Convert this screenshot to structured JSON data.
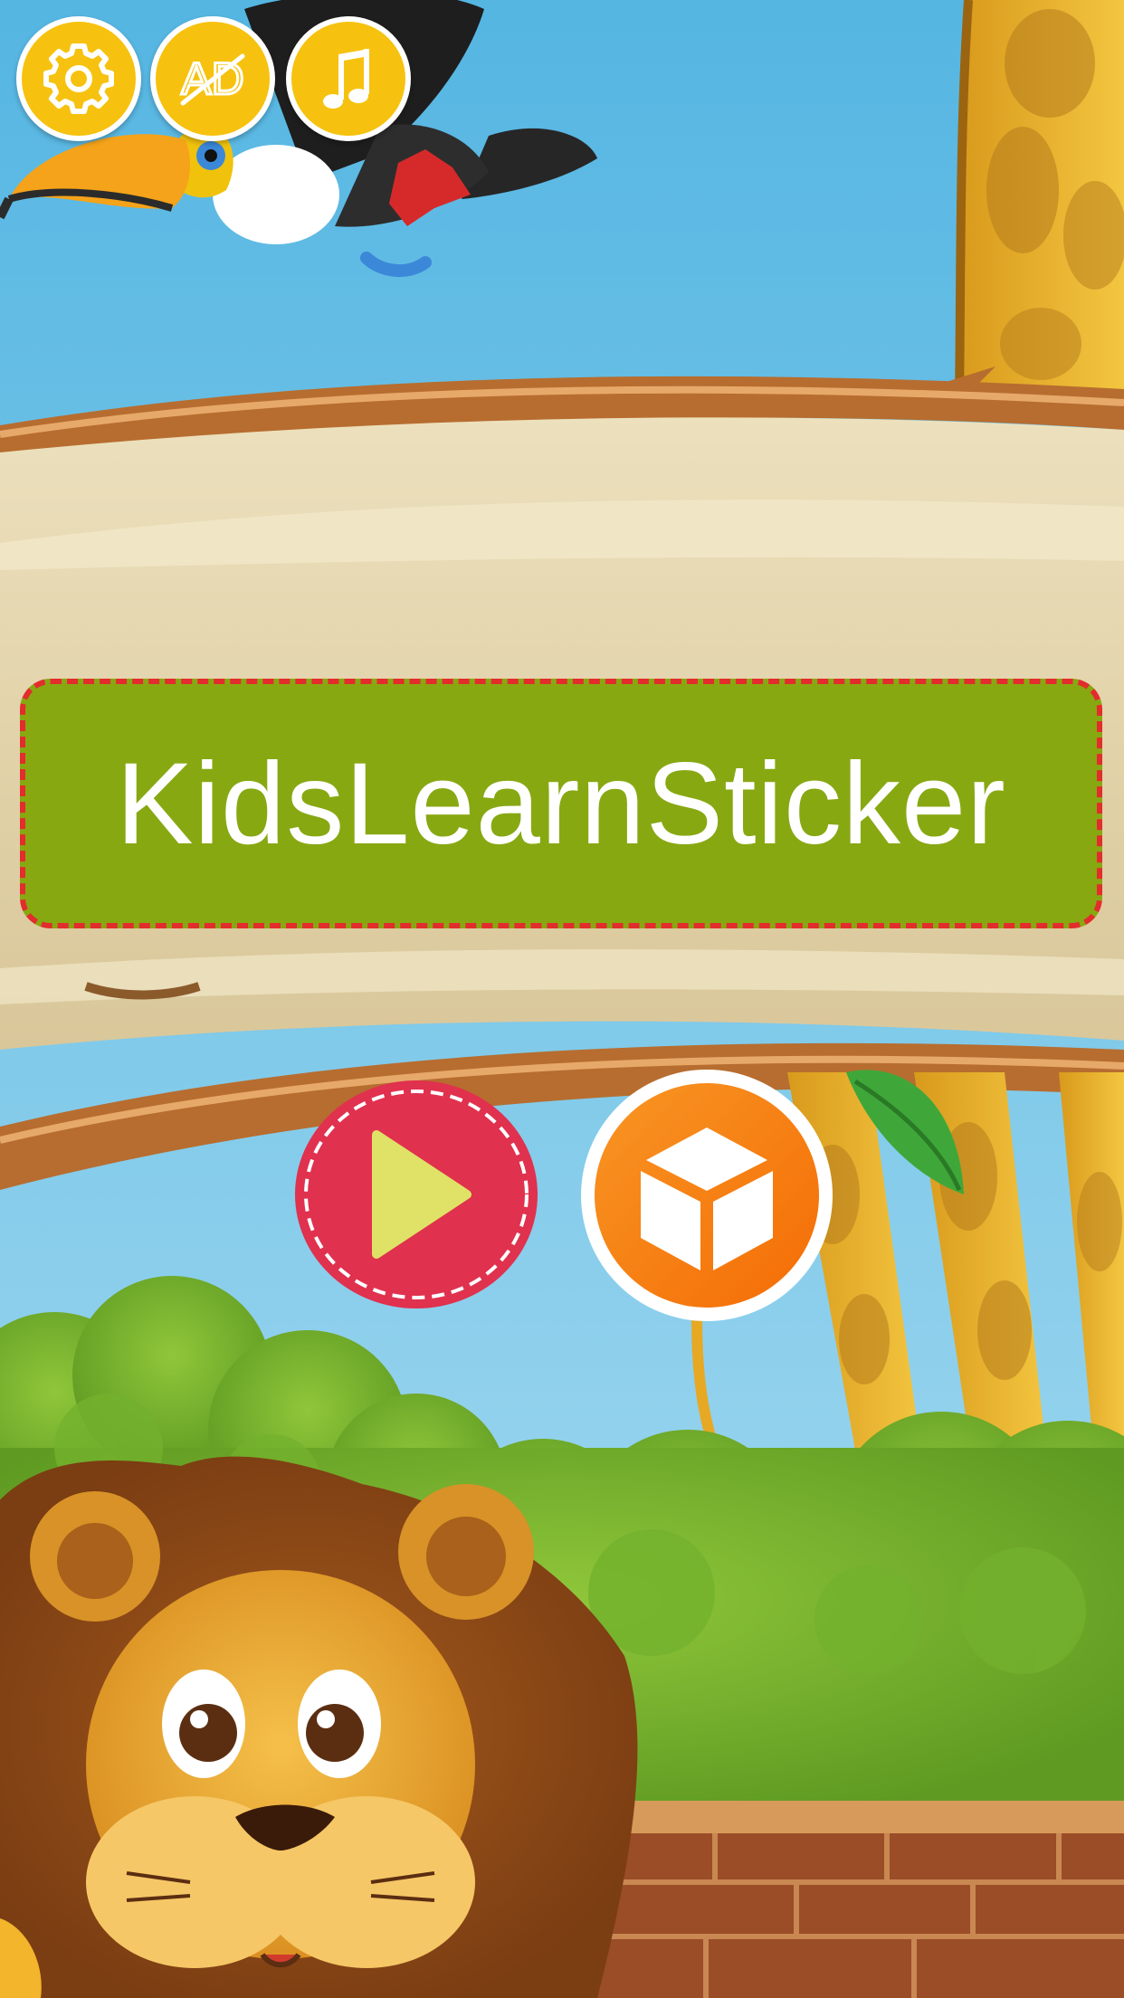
{
  "app": {
    "title": "KidsLearnSticker"
  },
  "top_bar": {
    "settings_icon": "gear-icon",
    "ads_icon": "no-ads-icon",
    "ads_label": "AD",
    "music_icon": "music-note-icon"
  },
  "main_menu": {
    "play_icon": "play-icon",
    "shop_icon": "cube-icon"
  },
  "colors": {
    "sky": "#6cc3e6",
    "top_button": "#f6c20f",
    "title_banner": "#88a812",
    "title_border": "#e32c2c",
    "play_button": "#e0314e",
    "play_triangle": "#dfe266",
    "shop_button": "#f5820d"
  }
}
